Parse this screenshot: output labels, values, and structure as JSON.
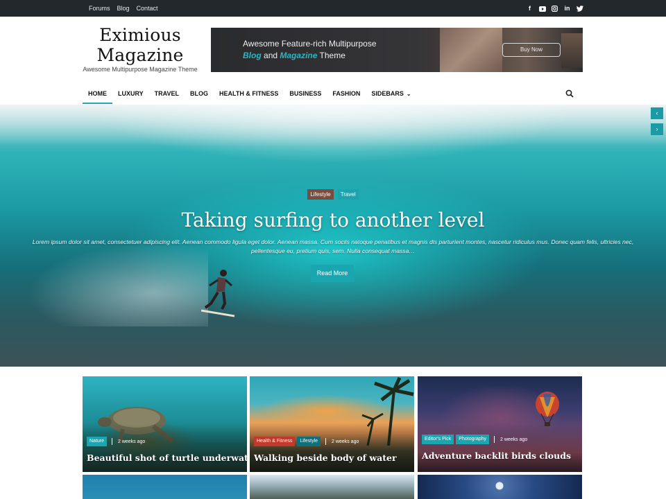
{
  "topbar": {
    "links": [
      "Forums",
      "Blog",
      "Contact"
    ],
    "social_icons": [
      "facebook-icon",
      "youtube-icon",
      "instagram-icon",
      "linkedin-icon",
      "twitter-icon"
    ]
  },
  "site": {
    "title_line1": "Eximious",
    "title_line2": "Magazine",
    "tagline": "Awesome Multipurpose Magazine Theme"
  },
  "banner": {
    "line1": "Awesome Feature-rich Multipurpose",
    "word_blog": "Blog",
    "word_and": "and",
    "word_magazine": "Magazine",
    "word_theme": "Theme",
    "button": "Buy Now"
  },
  "nav": {
    "items": [
      "HOME",
      "LUXURY",
      "TRAVEL",
      "BLOG",
      "HEALTH & FITNESS",
      "BUSINESS",
      "FASHION",
      "SIDEBARS"
    ],
    "active": "HOME",
    "search_icon": "search-icon"
  },
  "hero": {
    "categories": [
      "Lifestyle",
      "Travel"
    ],
    "title": "Taking surfing to another level",
    "excerpt_line1": "Lorem ipsum dolor sit amet, consectetuer adipiscing elit. Aenean commodo ligula eget dolor. Aenean massa. Cum sociis natoque penatibus et magnis dis parturient montes, nascetur ridiculus mus. Donec quam felis, ultricies nec,",
    "excerpt_line2": "pellentesque eu, pretium quis, sem. Nulla consequat massa…",
    "button": "Read More",
    "prev_icon": "chevron-left-icon",
    "next_icon": "chevron-right-icon"
  },
  "cards": [
    {
      "tags": [
        "Nature"
      ],
      "date": "2 weeks ago",
      "title": "Beautiful shot of turtle underwater"
    },
    {
      "tags": [
        "Health & Fitness",
        "Lifestyle"
      ],
      "date": "2 weeks ago",
      "title": "Walking beside body of water"
    },
    {
      "tags": [
        "Editor's Pick",
        "Photography"
      ],
      "date": "2 weeks ago",
      "title": "Adventure backlit birds clouds"
    }
  ],
  "colors": {
    "accent": "#1aa6b1",
    "topbar": "#23282d",
    "lifestyle_tag": "#7b4b3e",
    "health_tag": "#c0392b"
  }
}
